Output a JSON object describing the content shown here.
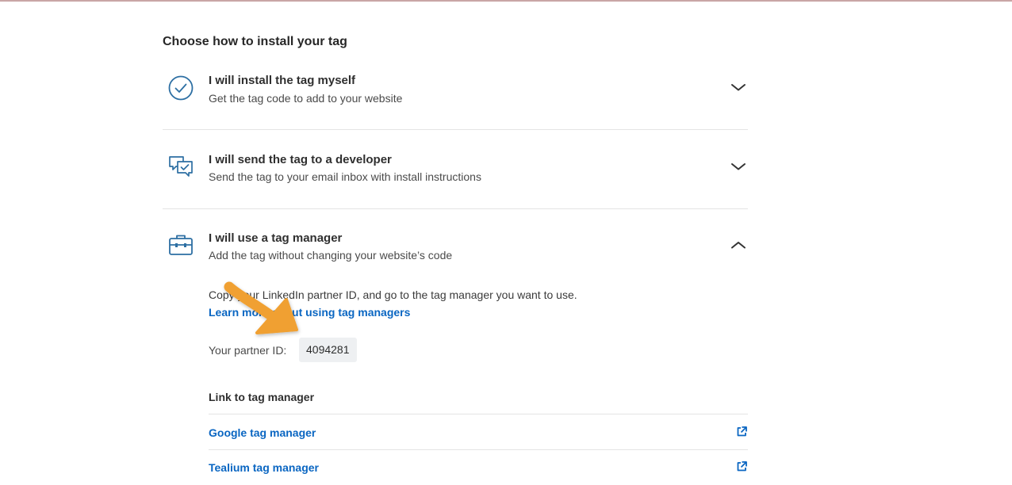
{
  "heading": "Choose how to install your tag",
  "options": [
    {
      "title": "I will install the tag myself",
      "subtitle": "Get the tag code to add to your website",
      "icon": "check-circle-icon",
      "expanded": false
    },
    {
      "title": "I will send the tag to a developer",
      "subtitle": "Send the tag to your email inbox with install instructions",
      "icon": "message-check-icon",
      "expanded": false
    },
    {
      "title": "I will use a tag manager",
      "subtitle": "Add the tag without changing your website’s code",
      "icon": "briefcase-icon",
      "expanded": true
    }
  ],
  "tag_manager_panel": {
    "description": "Copy your LinkedIn partner ID, and go to the tag manager you want to use.",
    "learn_more_link": "Learn more about using tag managers",
    "partner_id_label": "Your partner ID:",
    "partner_id_value": "4094281",
    "link_heading": "Link to tag manager",
    "tag_managers": [
      {
        "label": "Google tag manager",
        "icon": "external-link-icon"
      },
      {
        "label": "Tealium tag manager",
        "icon": "external-link-icon"
      }
    ]
  },
  "colors": {
    "link": "#0a66c2",
    "icon": "#2d6fa3",
    "annotation_arrow": "#f0a030"
  }
}
